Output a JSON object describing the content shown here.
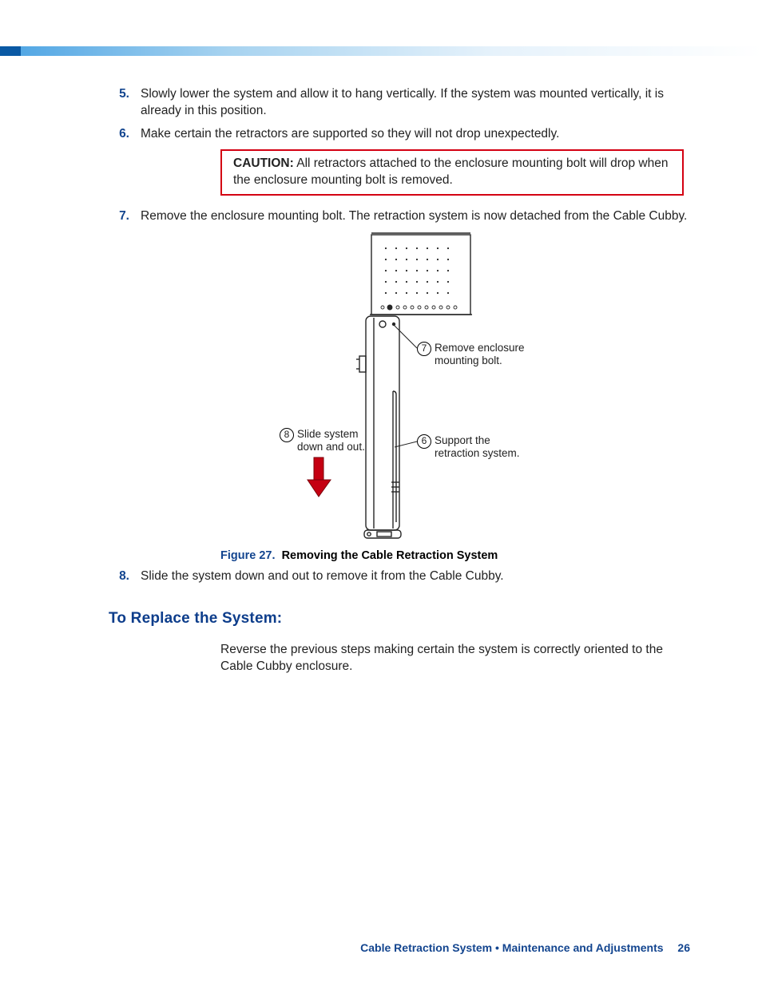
{
  "steps": {
    "s5": {
      "num": "5.",
      "text": "Slowly lower the system and allow it to hang vertically. If the system was mounted vertically, it is already in this position."
    },
    "s6": {
      "num": "6.",
      "text": "Make certain the retractors are supported so they will not drop unexpectedly."
    },
    "s7": {
      "num": "7.",
      "text": "Remove the enclosure mounting bolt. The retraction system is now detached from the Cable Cubby."
    },
    "s8": {
      "num": "8.",
      "text": "Slide the system down and out to remove it from the Cable Cubby."
    }
  },
  "caution": {
    "label": "CAUTION:",
    "text": "All retractors attached to the enclosure mounting bolt will drop when the enclosure mounting bolt is removed."
  },
  "figure": {
    "number": "Figure 27.",
    "title": "Removing the Cable Retraction System",
    "callouts": {
      "c7": {
        "num": "7",
        "text": "Remove enclosure mounting bolt."
      },
      "c6": {
        "num": "6",
        "text": "Support the retraction system."
      },
      "c8": {
        "num": "8",
        "text": "Slide system down and out."
      }
    }
  },
  "section": {
    "heading": "To Replace the System:",
    "body": "Reverse the previous steps making certain the system is correctly oriented to the Cable Cubby enclosure."
  },
  "footer": {
    "text": "Cable Retraction System • Maintenance and Adjustments",
    "page": "26"
  }
}
